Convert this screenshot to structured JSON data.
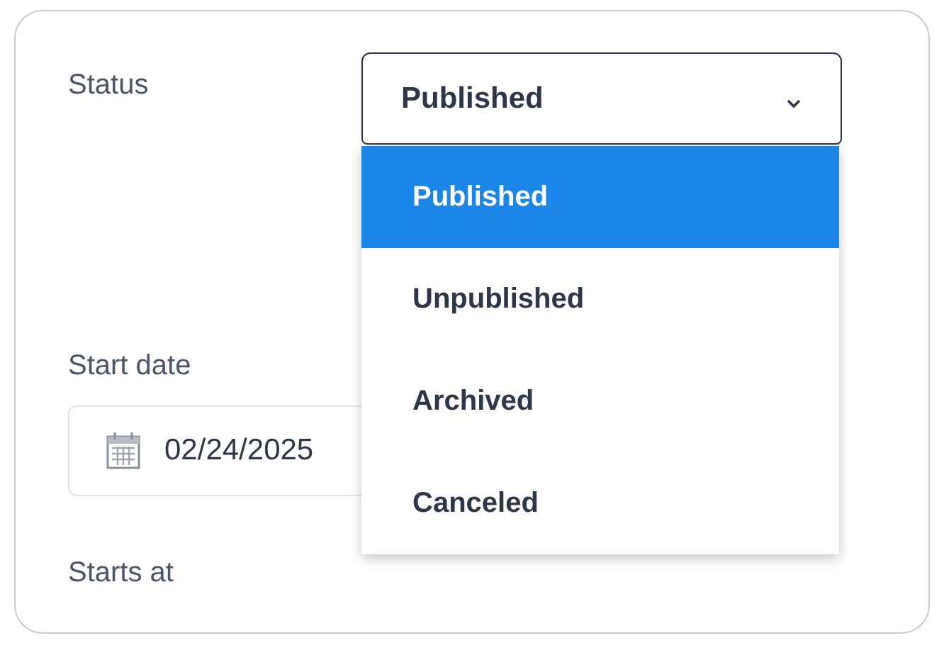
{
  "status": {
    "label": "Status",
    "value": "Published",
    "expanded": true,
    "options": [
      {
        "label": "Published",
        "selected": true
      },
      {
        "label": "Unpublished",
        "selected": false
      },
      {
        "label": "Archived",
        "selected": false
      },
      {
        "label": "Canceled",
        "selected": false
      }
    ]
  },
  "start_date": {
    "label": "Start date",
    "value": "02/24/2025"
  },
  "starts_at": {
    "label": "Starts at"
  }
}
